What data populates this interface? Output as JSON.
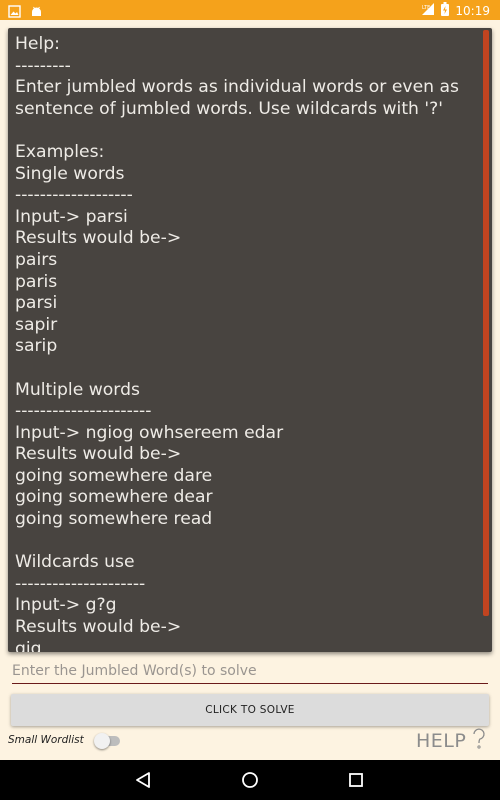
{
  "status_bar": {
    "time": "10:19",
    "icons": [
      "image-icon",
      "android-icon",
      "lte-signal-icon",
      "battery-icon"
    ]
  },
  "help": {
    "text": "Help:\n---------\nEnter jumbled words as individual words or even as sentence of jumbled words. Use wildcards with '?'\n\nExamples:\nSingle words\n-------------------\nInput-> parsi\nResults would be->\npairs\nparis\nparsi\nsapir\nsarip\n\nMultiple words\n----------------------\nInput-> ngiog owhsereem edar\nResults would be->\ngoing somewhere dare\ngoing somewhere dear\ngoing somewhere read\n\nWildcards use\n---------------------\nInput-> g?g\nResults would be->\ngig"
  },
  "input": {
    "placeholder": "Enter the Jumbled Word(s) to solve",
    "value": ""
  },
  "solve_button": {
    "label": "CLICK TO SOLVE"
  },
  "wordlist": {
    "label": "Small Wordlist",
    "enabled": false
  },
  "help_link": {
    "label": "HELP"
  },
  "nav": {
    "icons": [
      "back-icon",
      "home-icon",
      "recents-icon"
    ]
  },
  "colors": {
    "status_bar": "#F5A21B",
    "background": "#FDF3E1",
    "panel": "#484440",
    "scrollbar": "#C14420"
  }
}
